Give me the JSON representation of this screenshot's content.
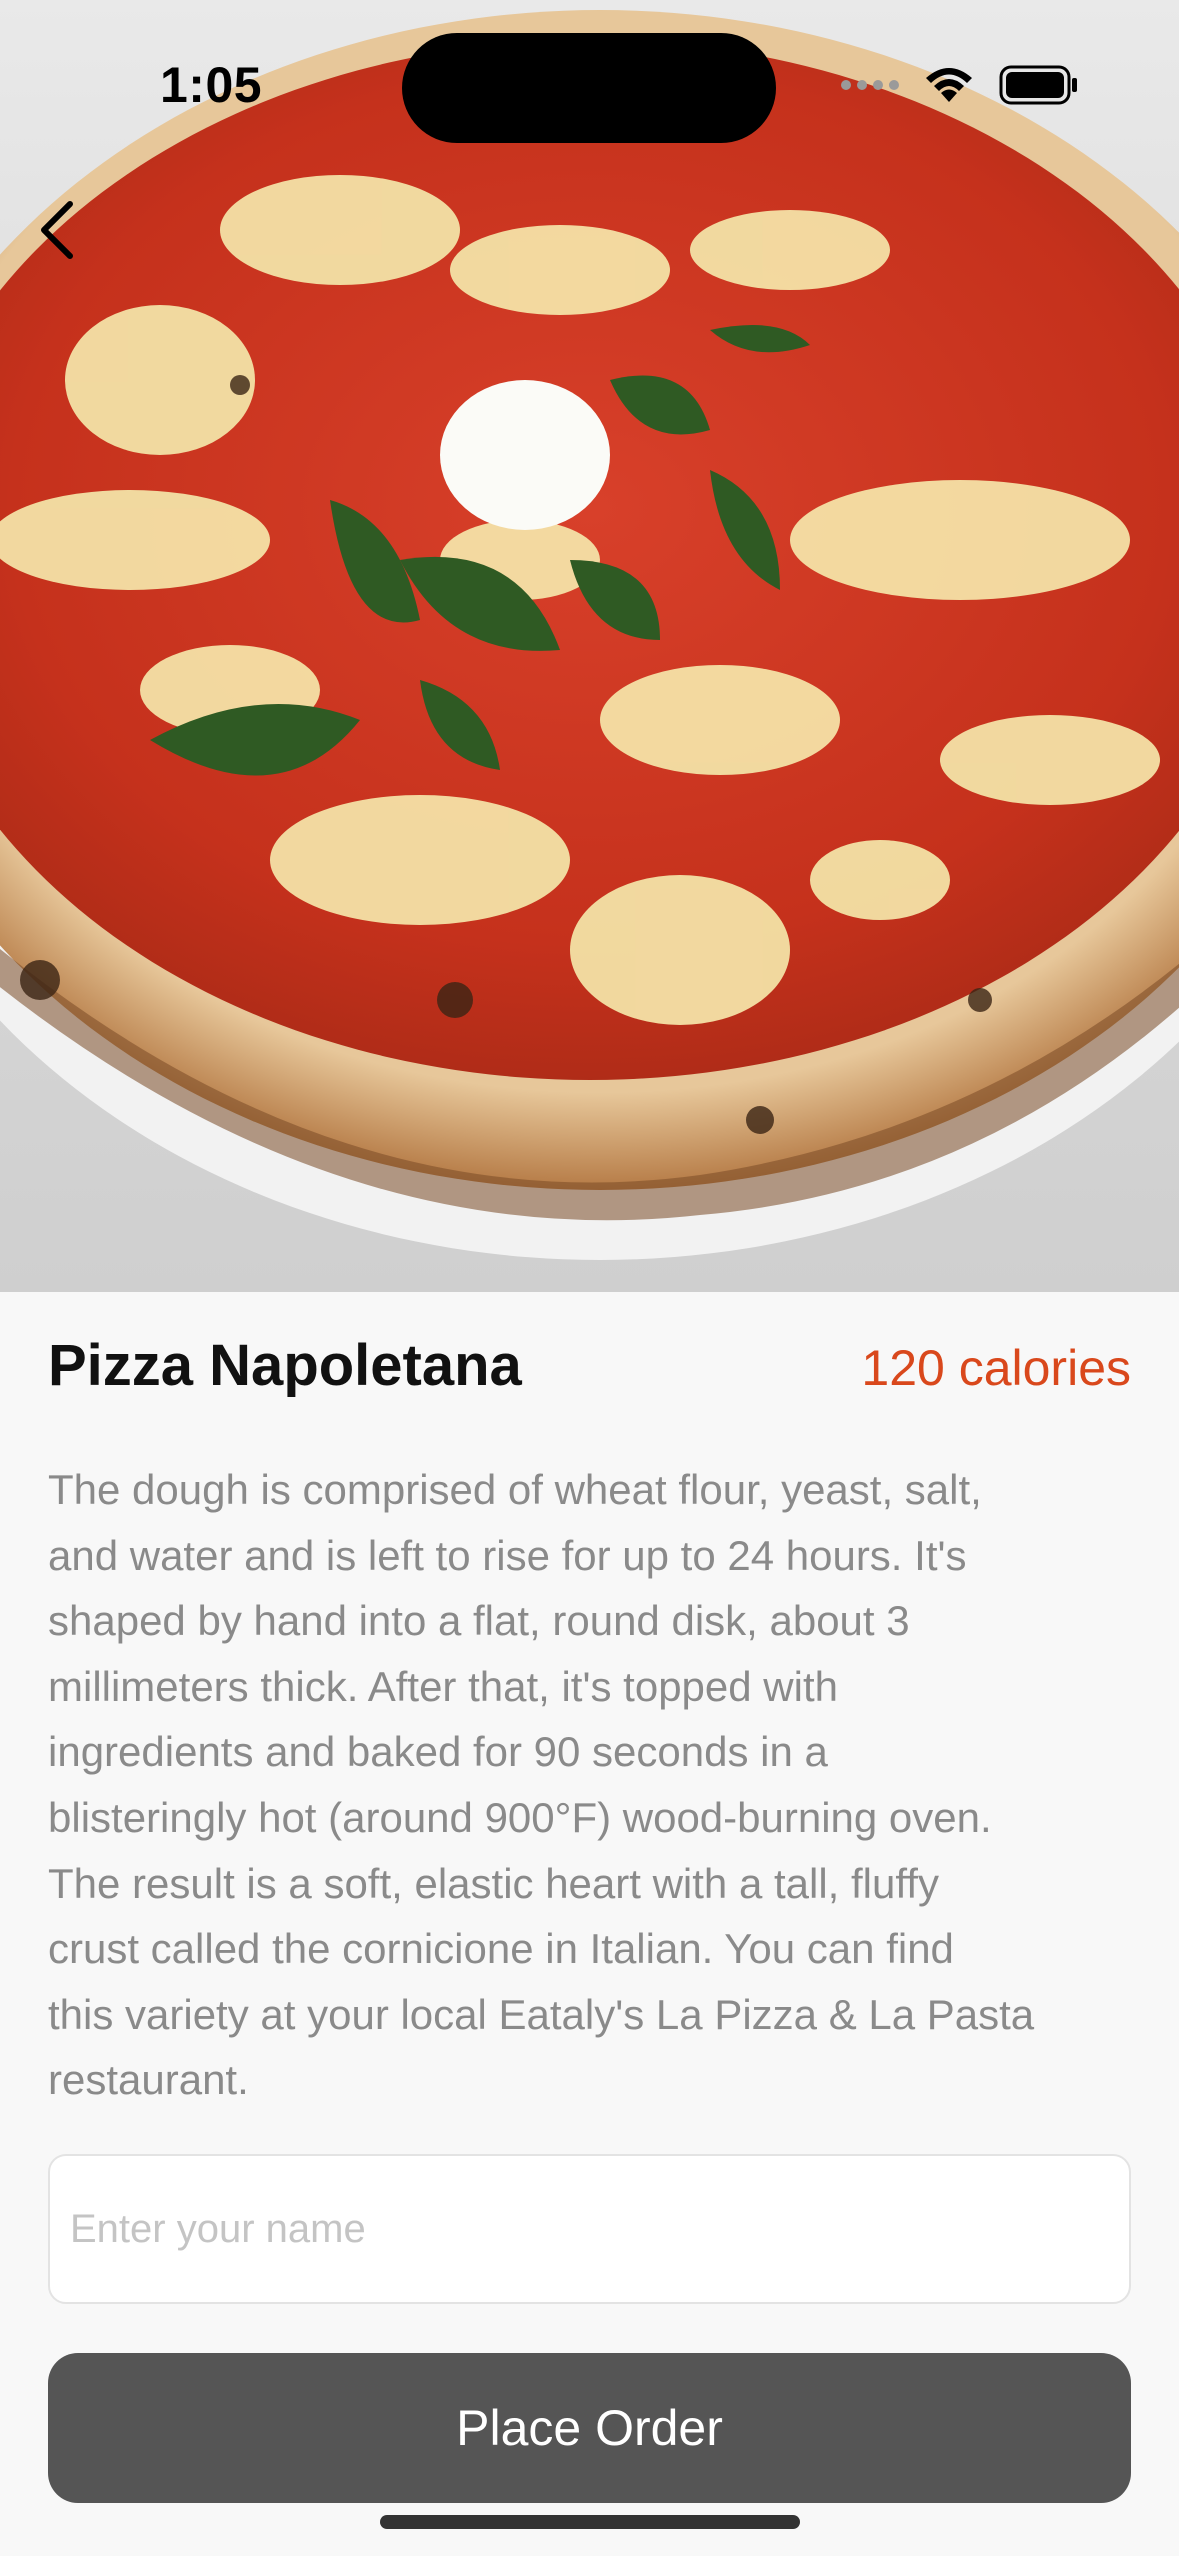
{
  "status_bar": {
    "time": "1:05",
    "icons": [
      "signal-dots-icon",
      "wifi-icon",
      "battery-icon"
    ]
  },
  "nav": {
    "back_icon": "chevron-left-icon"
  },
  "hero": {
    "image": "pizza-photo"
  },
  "dish": {
    "title": "Pizza Napoletana",
    "calories": "120 calories",
    "description_lines": [
      "The dough is comprised of wheat flour, yeast, salt,",
      "and water and is left to rise for up to 24 hours. It's",
      "shaped by hand into a flat, round disk, about 3",
      "millimeters thick. After that, it's topped with",
      "ingredients and baked for 90 seconds in a",
      "blisteringly hot (around 900°F) wood-burning oven.",
      "The result is a soft, elastic heart with a tall, fluffy",
      "crust called the cornicione in Italian. You can find",
      "this variety at your local Eataly's La Pizza & La Pasta",
      "restaurant."
    ]
  },
  "form": {
    "name_placeholder": "Enter your name",
    "name_value": "",
    "submit_label": "Place Order"
  },
  "colors": {
    "accent": "#d9481c",
    "button": "#555555",
    "background": "#f8f8f8",
    "description_text": "#8a8a8a"
  }
}
